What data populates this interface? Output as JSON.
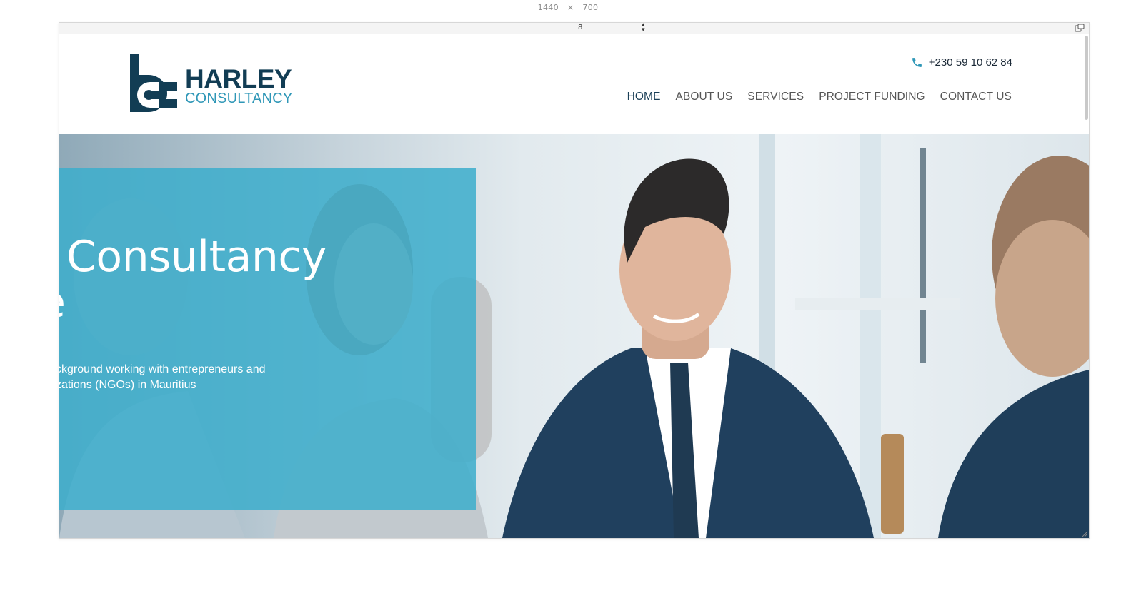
{
  "viewport": {
    "width": "1440",
    "separator": "×",
    "height": "700"
  },
  "toolbar": {
    "zoom": "8",
    "zoom_arrows": "▲▼"
  },
  "brand": {
    "name_line1": "HARLEY",
    "name_line2": "CONSULTANCY",
    "primary_color": "#123d54",
    "accent_color": "#2f97b7"
  },
  "header": {
    "phone": "+230 59 10 62 84"
  },
  "nav": {
    "items": [
      {
        "label": "HOME",
        "active": true
      },
      {
        "label": "ABOUT US"
      },
      {
        "label": "SERVICES"
      },
      {
        "label": "PROJECT FUNDING"
      },
      {
        "label": "CONTACT US"
      }
    ]
  },
  "hero": {
    "title_line1": "Consultancy",
    "title_line2": "e",
    "subtitle_line1": "ckground working with entrepreneurs and",
    "subtitle_line2": "zations (NGOs) in Mauritius",
    "overlay_color": "#3dadcc"
  }
}
